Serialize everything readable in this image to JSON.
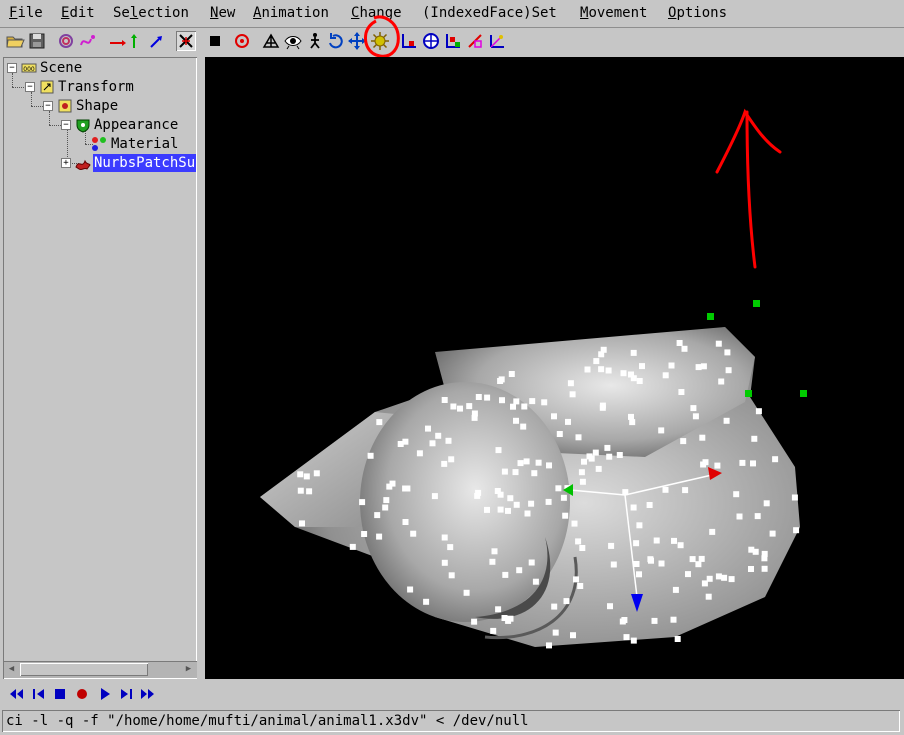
{
  "menubar": {
    "items": [
      {
        "pre": "",
        "u": "F",
        "post": "ile"
      },
      {
        "pre": "",
        "u": "E",
        "post": "dit"
      },
      {
        "pre": "Se",
        "u": "l",
        "post": "ection"
      },
      {
        "pre": "",
        "u": "N",
        "post": "ew"
      },
      {
        "pre": "",
        "u": "A",
        "post": "nimation"
      },
      {
        "pre": "",
        "u": "C",
        "post": "hange"
      },
      {
        "pre": "(IndexedFace)Set",
        "u": "",
        "post": ""
      },
      {
        "pre": "",
        "u": "M",
        "post": "ovement"
      },
      {
        "pre": "",
        "u": "O",
        "post": "ptions"
      }
    ]
  },
  "toolbar": {
    "icons": [
      "open-icon",
      "save-icon",
      "rings-icon",
      "curve-icon",
      "move-x-icon",
      "move-y-icon",
      "move-z-icon",
      "x-cursor-icon",
      "stop-icon",
      "target-icon",
      "mesh-icon",
      "eye-icon",
      "walker-icon",
      "rotate-icon",
      "move-all-icon",
      "sun-gear-icon",
      "axes-icon",
      "globe-icon",
      "color-axes-icon",
      "scale-icon",
      "transform-axes-icon"
    ],
    "annotation_color": "#ff0000"
  },
  "tree": {
    "nodes": [
      {
        "label": "Scene",
        "icon": "scene-icon"
      },
      {
        "label": "Transform",
        "icon": "transform-icon"
      },
      {
        "label": "Shape",
        "icon": "shape-icon"
      },
      {
        "label": "Appearance",
        "icon": "appearance-icon"
      },
      {
        "label": "Material",
        "icon": "material-icon"
      },
      {
        "label": "NurbsPatchSu",
        "icon": "nurbs-icon",
        "selected": true
      }
    ],
    "selection_color": "#3c3cff"
  },
  "viewport": {
    "background": "#000000",
    "control_point_color": "#ffffff",
    "handle_color": "#00cc00",
    "axis_colors": {
      "x": "#ff0000",
      "y": "#00c000",
      "z": "#0000ff"
    },
    "annotation_color": "#ff0000"
  },
  "animbar": {
    "icons": [
      "rewind-icon",
      "step-back-icon",
      "stop-icon",
      "record-icon",
      "play-icon",
      "step-forward-icon",
      "fast-forward-icon"
    ]
  },
  "status": {
    "command": "ci -l -q -f \"/home/home/mufti/animal/animal1.x3dv\" < /dev/null"
  }
}
